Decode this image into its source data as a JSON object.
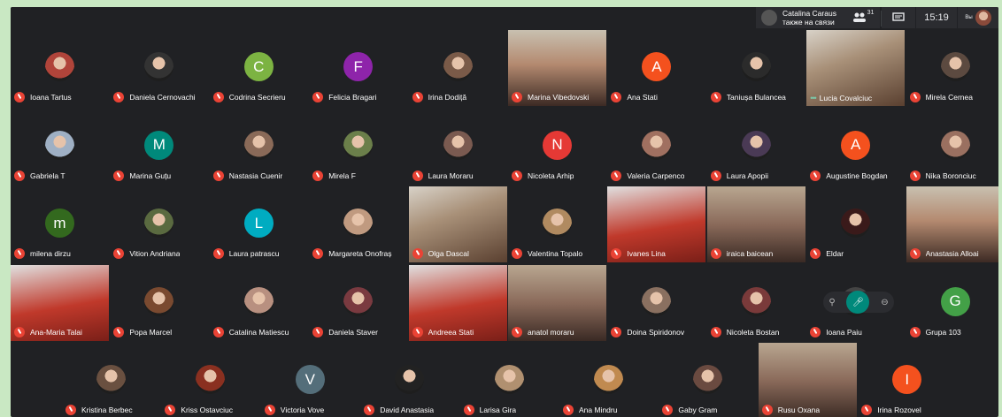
{
  "topbar": {
    "presenter_name": "Catalina Caraus",
    "presenter_status": "также на связи",
    "people_icon": "people-icon",
    "people_count": "31",
    "chat_icon": "chat-icon",
    "time": "15:19",
    "user_label": "Вы"
  },
  "participants": [
    {
      "name": "Ioana Tartus",
      "avatar": "photo",
      "color": "#b0443a"
    },
    {
      "name": "Daniela Cernovachi",
      "avatar": "photo",
      "color": "#333333"
    },
    {
      "name": "Codrina Secrieru",
      "avatar": "letter",
      "letter": "C",
      "color": "#7cb342"
    },
    {
      "name": "Felicia Bragari",
      "avatar": "letter",
      "letter": "F",
      "color": "#8e24aa"
    },
    {
      "name": "Irina Dodiță",
      "avatar": "photo",
      "color": "#7a5a48"
    },
    {
      "name": "Marina Vibedovski",
      "avatar": "video"
    },
    {
      "name": "Ana Stati",
      "avatar": "letter",
      "letter": "A",
      "color": "#f4511e"
    },
    {
      "name": "Taniușa Bulancea",
      "avatar": "photo",
      "color": "#2b2b2b"
    },
    {
      "name": "Lucia Covalciuc",
      "avatar": "video",
      "speaking": true
    },
    {
      "name": "Mirela Cernea",
      "avatar": "photo",
      "color": "#5c4a40"
    },
    {
      "name": "Gabriela T",
      "avatar": "photo",
      "color": "#9fb0c4"
    },
    {
      "name": "Marina Guțu",
      "avatar": "letter",
      "letter": "M",
      "color": "#00897b"
    },
    {
      "name": "Nastasia Cuenir",
      "avatar": "photo",
      "color": "#8a6a58"
    },
    {
      "name": "Mirela F",
      "avatar": "photo",
      "color": "#6b7f4a"
    },
    {
      "name": "Laura Moraru",
      "avatar": "photo",
      "color": "#7a5a50"
    },
    {
      "name": "Nicoleta Arhip",
      "avatar": "letter",
      "letter": "N",
      "color": "#e53935"
    },
    {
      "name": "Valeria Carpenco",
      "avatar": "photo",
      "color": "#a07060"
    },
    {
      "name": "Laura Apopii",
      "avatar": "photo",
      "color": "#4a3a55"
    },
    {
      "name": "Augustine Bogdan",
      "avatar": "letter",
      "letter": "A",
      "color": "#f4511e"
    },
    {
      "name": "Nika Boronciuc",
      "avatar": "photo",
      "color": "#9a7060"
    },
    {
      "name": "milena dirzu",
      "avatar": "letter",
      "letter": "m",
      "color": "#33691e"
    },
    {
      "name": "Vition Andriana",
      "avatar": "photo",
      "color": "#5a6a40"
    },
    {
      "name": "Laura patrascu",
      "avatar": "letter",
      "letter": "L",
      "color": "#00acc1"
    },
    {
      "name": "Margareta Onofraș",
      "avatar": "photo",
      "color": "#c09a80"
    },
    {
      "name": "Olga Dascal",
      "avatar": "video"
    },
    {
      "name": "Valentina Topalo",
      "avatar": "photo",
      "color": "#b08a60"
    },
    {
      "name": "Ivanes Lina",
      "avatar": "video"
    },
    {
      "name": "iraica baicean",
      "avatar": "video"
    },
    {
      "name": "Eldar",
      "avatar": "photo",
      "color": "#3a1a1a"
    },
    {
      "name": "Anastasia Alloai",
      "avatar": "video"
    },
    {
      "name": "Ana-Maria Talai",
      "avatar": "video"
    },
    {
      "name": "Popa Marcel",
      "avatar": "photo",
      "color": "#7a4a30"
    },
    {
      "name": "Catalina Matiescu",
      "avatar": "photo",
      "color": "#b89080"
    },
    {
      "name": "Daniela Staver",
      "avatar": "photo",
      "color": "#7a3a40"
    },
    {
      "name": "Andreea Stati",
      "avatar": "video"
    },
    {
      "name": "anatol moraru",
      "avatar": "video"
    },
    {
      "name": "Doina Spiridonov",
      "avatar": "photo",
      "color": "#8a7060"
    },
    {
      "name": "Nicoleta Bostan",
      "avatar": "photo",
      "color": "#7a3a3a"
    },
    {
      "name": "Ioana Paiu",
      "avatar": "photo",
      "color": "#444444"
    },
    {
      "name": "Grupa 103",
      "avatar": "letter",
      "letter": "G",
      "color": "#43a047"
    },
    {
      "name": "Kristina Berbec",
      "avatar": "photo",
      "color": "#6a5040"
    },
    {
      "name": "Kriss Ostavciuc",
      "avatar": "photo",
      "color": "#8a3020"
    },
    {
      "name": "Victoria Vove",
      "avatar": "letter",
      "letter": "V",
      "color": "#546e7a"
    },
    {
      "name": "David Anastasia",
      "avatar": "photo",
      "color": "#222222"
    },
    {
      "name": "Larisa Gira",
      "avatar": "photo",
      "color": "#b09070"
    },
    {
      "name": "Ana Mindru",
      "avatar": "photo",
      "color": "#c08a50"
    },
    {
      "name": "Gaby Gram",
      "avatar": "photo",
      "color": "#6a4a40"
    },
    {
      "name": "Rusu Oxana",
      "avatar": "video"
    },
    {
      "name": "Irina Rozovel",
      "avatar": "letter",
      "letter": "I",
      "color": "#f4511e"
    }
  ]
}
